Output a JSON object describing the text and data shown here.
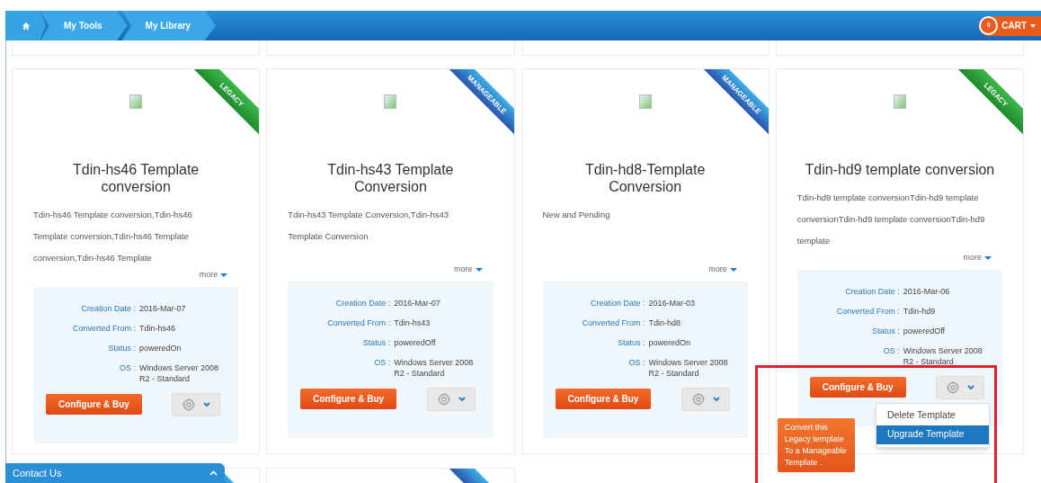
{
  "breadcrumb": {
    "items": [
      "My Tools",
      "My Library"
    ]
  },
  "cart": {
    "count": "0",
    "label": "CART"
  },
  "cards": [
    {
      "ribbon": {
        "label": "LEGACY",
        "kind": "legacy"
      },
      "title": "Tdin-hs46 Template conversion",
      "description": "Tdin-hs46 Template conversion,Tdin-hs46 Template conversion,Tdin-hs46 Template conversion,Tdin-hs46 Template",
      "more": "more",
      "details": [
        {
          "label": "Creation Date :",
          "value": "2016-Mar-07"
        },
        {
          "label": "Converted From :",
          "value": "Tdin-hs46"
        },
        {
          "label": "Status :",
          "value": "poweredOn"
        },
        {
          "label": "OS :",
          "value": "Windows Server 2008 R2 - Standard"
        }
      ],
      "configure": "Configure & Buy",
      "highlighted": false
    },
    {
      "ribbon": {
        "label": "MANAGEABLE",
        "kind": "manageable"
      },
      "title": "Tdin-hs43 Template Conversion",
      "description": "Tdin-hs43 Template Conversion,Tdin-hs43 Template Conversion",
      "more": "more",
      "details": [
        {
          "label": "Creation Date :",
          "value": "2016-Mar-07"
        },
        {
          "label": "Converted From :",
          "value": "Tdin-hs43"
        },
        {
          "label": "Status :",
          "value": "poweredOff"
        },
        {
          "label": "OS :",
          "value": "Windows Server 2008 R2 - Standard"
        }
      ],
      "configure": "Configure & Buy",
      "highlighted": false
    },
    {
      "ribbon": {
        "label": "MANAGEABLE",
        "kind": "manageable"
      },
      "title": "Tdin-hd8-Template Conversion",
      "description": "New and Pending",
      "more": "more",
      "details": [
        {
          "label": "Creation Date :",
          "value": "2016-Mar-03"
        },
        {
          "label": "Converted From :",
          "value": "Tdin-hd8"
        },
        {
          "label": "Status :",
          "value": "poweredOn"
        },
        {
          "label": "OS :",
          "value": "Windows Server 2008 R2 - Standard"
        }
      ],
      "configure": "Configure & Buy",
      "highlighted": false
    },
    {
      "ribbon": {
        "label": "LEGACY",
        "kind": "legacy"
      },
      "title": "Tdin-hd9 template conversion",
      "description": "Tdin-hd9 template conversionTdin-hd9 template conversionTdin-hd9 template conversionTdin-hd9 template",
      "more": "more",
      "details": [
        {
          "label": "Creation Date :",
          "value": "2016-Mar-06"
        },
        {
          "label": "Converted From :",
          "value": "Tdin-hd9"
        },
        {
          "label": "Status :",
          "value": "poweredOff"
        },
        {
          "label": "OS :",
          "value": "Windows Server 2008 R2 - Standard"
        }
      ],
      "configure": "Configure & Buy",
      "highlighted": true,
      "menu": [
        {
          "label": "Delete Template",
          "selected": false
        },
        {
          "label": "Upgrade Template",
          "selected": true
        }
      ],
      "tooltip": "Convert this Legacy template To a Manageable Template ."
    }
  ],
  "bottom_cards": [
    {
      "kind": "manageable"
    },
    {
      "kind": "manageable"
    }
  ],
  "contact": {
    "label": "Contact Us"
  }
}
